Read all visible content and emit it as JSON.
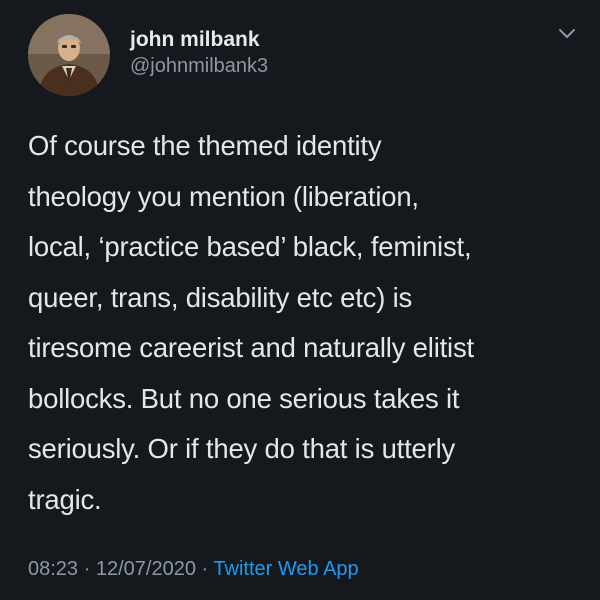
{
  "author": {
    "display_name": "john milbank",
    "handle": "@johnmilbank3"
  },
  "icons": {
    "avatar": "profile-photo",
    "menu": "chevron-down-icon"
  },
  "tweet": {
    "lines": [
      "Of course the themed identity",
      "theology you mention (liberation,",
      "local, ‘practice based’ black, feminist,",
      "queer, trans, disability etc etc) is",
      "tiresome careerist and naturally elitist",
      "bollocks. But no one serious takes it",
      "seriously. Or if they do that is utterly",
      "tragic."
    ]
  },
  "meta": {
    "time": "08:23",
    "separator": "·",
    "date": "12/07/2020",
    "source": "Twitter Web App"
  },
  "colors": {
    "background": "#15181c",
    "text": "#e7e9ea",
    "secondary": "#8b98a5",
    "link": "#1d9bf0"
  }
}
